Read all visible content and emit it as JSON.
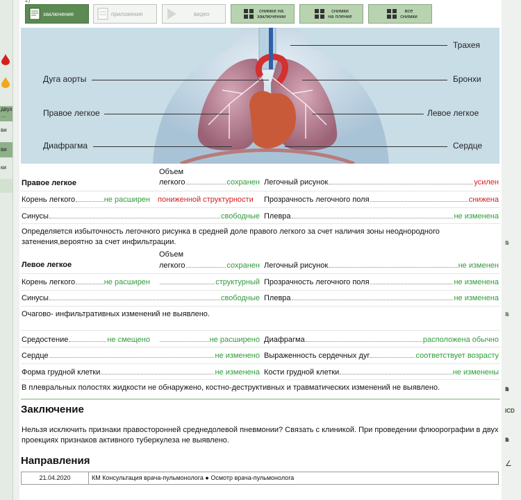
{
  "top_number": "2)",
  "sidebar": {
    "items": [
      {
        "label": "двух\n…"
      },
      {
        "label": "ви"
      },
      {
        "label": "ви"
      },
      {
        "label": "ки"
      }
    ],
    "drop_colors": [
      "#d81e1e",
      "#f0a81c"
    ]
  },
  "toolbar": {
    "buttons": [
      {
        "label": "заключение",
        "icon": "document-icon",
        "state": "active"
      },
      {
        "label": "приложения",
        "icon": "attachment-icon",
        "state": "disabled"
      },
      {
        "label": "видео",
        "icon": "play-icon",
        "state": "disabled"
      },
      {
        "label": "снимки на\nзаключении",
        "icon": "images-icon",
        "state": "green"
      },
      {
        "label": "снимки\nна пленке",
        "icon": "film-icon",
        "state": "green"
      },
      {
        "label": "все\nснимки",
        "icon": "grid-icon",
        "state": "green"
      }
    ]
  },
  "illustration": {
    "labels": {
      "trachea": "Трахея",
      "aorta": "Дуга аорты",
      "bronchi": "Бронхи",
      "right_lung": "Правое легкое",
      "left_lung": "Левое легкое",
      "diaphragm": "Диафрагма",
      "heart": "Сердце"
    }
  },
  "right_lung": {
    "title": "Правое легкое",
    "volume_label_top": "Объем",
    "volume_label": "легкого",
    "volume_value": "сохранен",
    "pattern_label": "Легочный рисунок",
    "pattern_value": "усилен",
    "root_label": "Корень легкого",
    "root_value": "не расширен",
    "structure_value": "пониженной структурности",
    "transparency_label": "Прозрачность легочного поля",
    "transparency_value": "снижена",
    "sinuses_label": "Синусы",
    "sinuses_value": "свободные",
    "pleura_label": "Плевра",
    "pleura_value": "не изменена",
    "note": "Определяется избыточность легочного рисунка в средней доле правого легкого за счет наличия зоны неоднородного затенения,вероятно за счет инфильтрации."
  },
  "left_lung": {
    "title": "Левое легкое",
    "volume_label_top": "Объем",
    "volume_label": "легкого",
    "volume_value": "сохранен",
    "pattern_label": "Легочный рисунок",
    "pattern_value": "не изменен",
    "root_label": "Корень легкого",
    "root_value": "не расширен",
    "structure_value": "структурный",
    "transparency_label": "Прозрачность легочного поля",
    "transparency_value": "не изменена",
    "sinuses_label": "Синусы",
    "sinuses_value": "свободные",
    "pleura_label": "Плевра",
    "pleura_value": "не изменена",
    "note": "Очагово- инфильтративных изменений не выявлено."
  },
  "general": {
    "mediastinum_label": "Средостение",
    "mediastinum_value": "не смещено",
    "mediastinum_width_value": "не расширено",
    "diaphragm_label": "Диафрагма",
    "diaphragm_value": "расположена обычно",
    "heart_label": "Сердце",
    "heart_value": "не изменено",
    "arcs_label": "Выраженность сердечных дуг",
    "arcs_value": "соответствует возрасту",
    "chest_shape_label": "Форма грудной клетки",
    "chest_shape_value": "не изменена",
    "chest_bones_label": "Кости грудной клетки",
    "chest_bones_value": "не изменены",
    "note": "В плевральных полостях жидкости не обнаружено, костно-деструктивных и травматических изменений не выявлено."
  },
  "conclusion": {
    "heading": "Заключение",
    "text": "Нельзя исключить признаки правосторонней среднедолевой пневмонии? Связать с клиникой. При проведении флюорографии в двух проекциях признаков активного туберкулеза не выявлено."
  },
  "directions": {
    "heading": "Направления",
    "date": "21.04.2020",
    "text": "КМ Консультация врача-пульмонолога ● Осмотр врача-пульмонолога"
  },
  "margin": {
    "icd_label": "ICD"
  }
}
